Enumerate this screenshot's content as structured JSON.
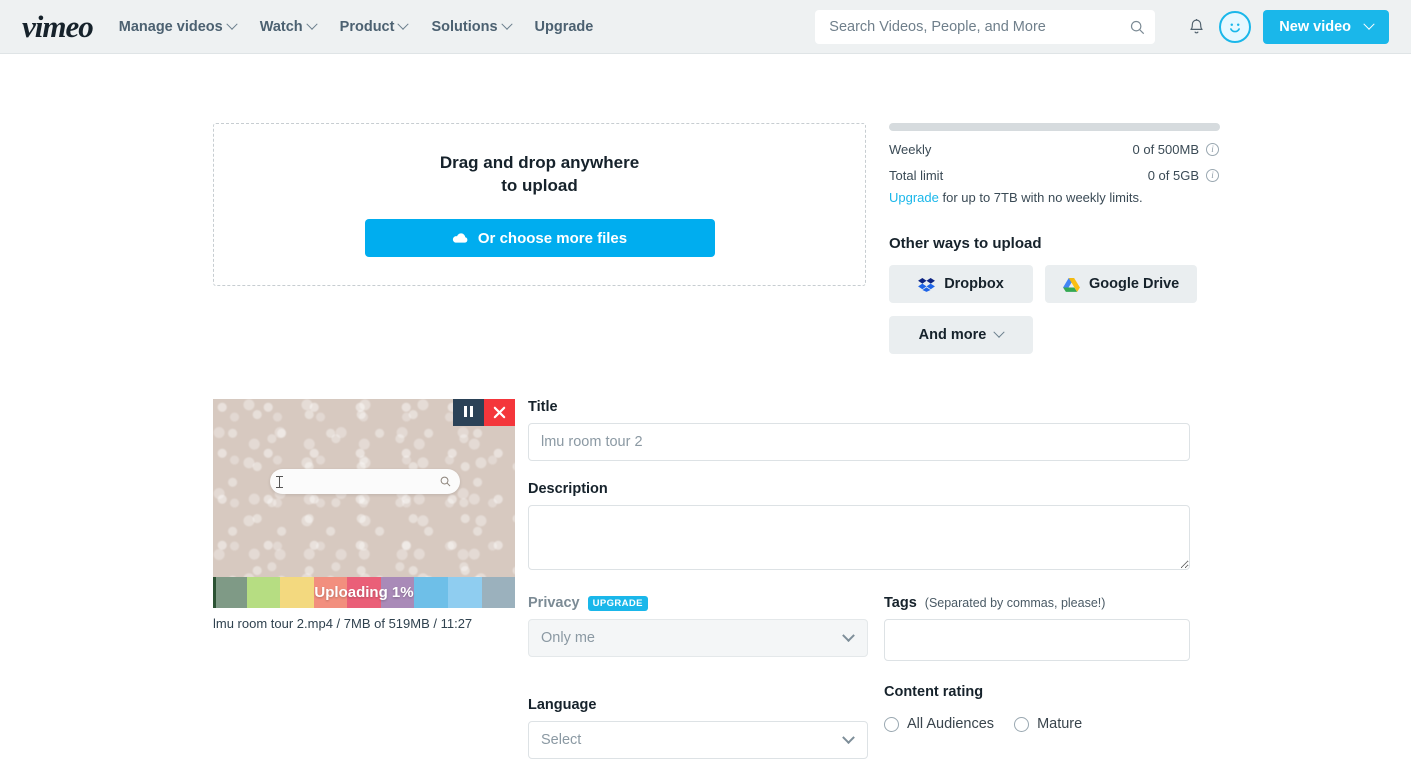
{
  "header": {
    "logo": "vimeo",
    "nav": [
      {
        "label": "Manage videos",
        "has_caret": true
      },
      {
        "label": "Watch",
        "has_caret": true
      },
      {
        "label": "Product",
        "has_caret": true
      },
      {
        "label": "Solutions",
        "has_caret": true
      },
      {
        "label": "Upgrade",
        "has_caret": false
      }
    ],
    "search": {
      "value": "",
      "placeholder": "Search Videos, People, and More",
      "icon": "search-icon"
    },
    "notifications_icon": "bell-icon",
    "avatar_icon": "user-avatar-smiley",
    "new_video_button": "New video"
  },
  "dropzone": {
    "title": "Drag and drop anywhere to upload",
    "choose_button": "Or choose more files",
    "choose_icon": "cloud-upload-icon"
  },
  "quota": {
    "progress_percent": 0,
    "rows": [
      {
        "label": "Weekly",
        "value": "0 of 500MB",
        "info_icon": "info-icon"
      },
      {
        "label": "Total limit",
        "value": "0 of 5GB",
        "info_icon": "info-icon"
      }
    ],
    "note_link": "Upgrade",
    "note_rest": " for up to 7TB with no weekly limits."
  },
  "other_ways": {
    "title": "Other ways to upload",
    "buttons": [
      {
        "label": "Dropbox",
        "icon": "dropbox-icon"
      },
      {
        "label": "Google Drive",
        "icon": "google-drive-icon"
      },
      {
        "label": "And more",
        "icon": "chevron-down-icon"
      }
    ]
  },
  "upload_item": {
    "status_text": "Uploading 1%",
    "progress_percent": 1,
    "caption": "lmu room tour 2.mp4 / 7MB of 519MB / 11:27",
    "pause_icon": "pause-icon",
    "cancel_icon": "close-icon",
    "thumb_colorbar": [
      "#7f9a86",
      "#b6dd82",
      "#f3d97f",
      "#f28f7e",
      "#ea5f78",
      "#a98ab8",
      "#6ebfe8",
      "#8fcdf0",
      "#9bb1bd"
    ]
  },
  "form": {
    "title": {
      "label": "Title",
      "value": "lmu room tour 2",
      "placeholder": "lmu room tour 2"
    },
    "description": {
      "label": "Description",
      "value": "",
      "placeholder": ""
    },
    "privacy": {
      "label": "Privacy",
      "badge": "UPGRADE",
      "value": "Only me",
      "disabled": true
    },
    "tags": {
      "label": "Tags",
      "hint": "(Separated by commas, please!)",
      "value": "",
      "placeholder": ""
    },
    "language": {
      "label": "Language",
      "value": "Select"
    },
    "content_rating": {
      "label": "Content rating",
      "options": [
        {
          "label": "All Audiences",
          "selected": false
        },
        {
          "label": "Mature",
          "selected": false
        }
      ]
    }
  },
  "colors": {
    "brand_blue": "#1ab7ea",
    "button_blue": "#00adef",
    "header_bg": "#eef1f2",
    "cancel_red": "#f4363b",
    "pause_navy": "#2b4257"
  }
}
